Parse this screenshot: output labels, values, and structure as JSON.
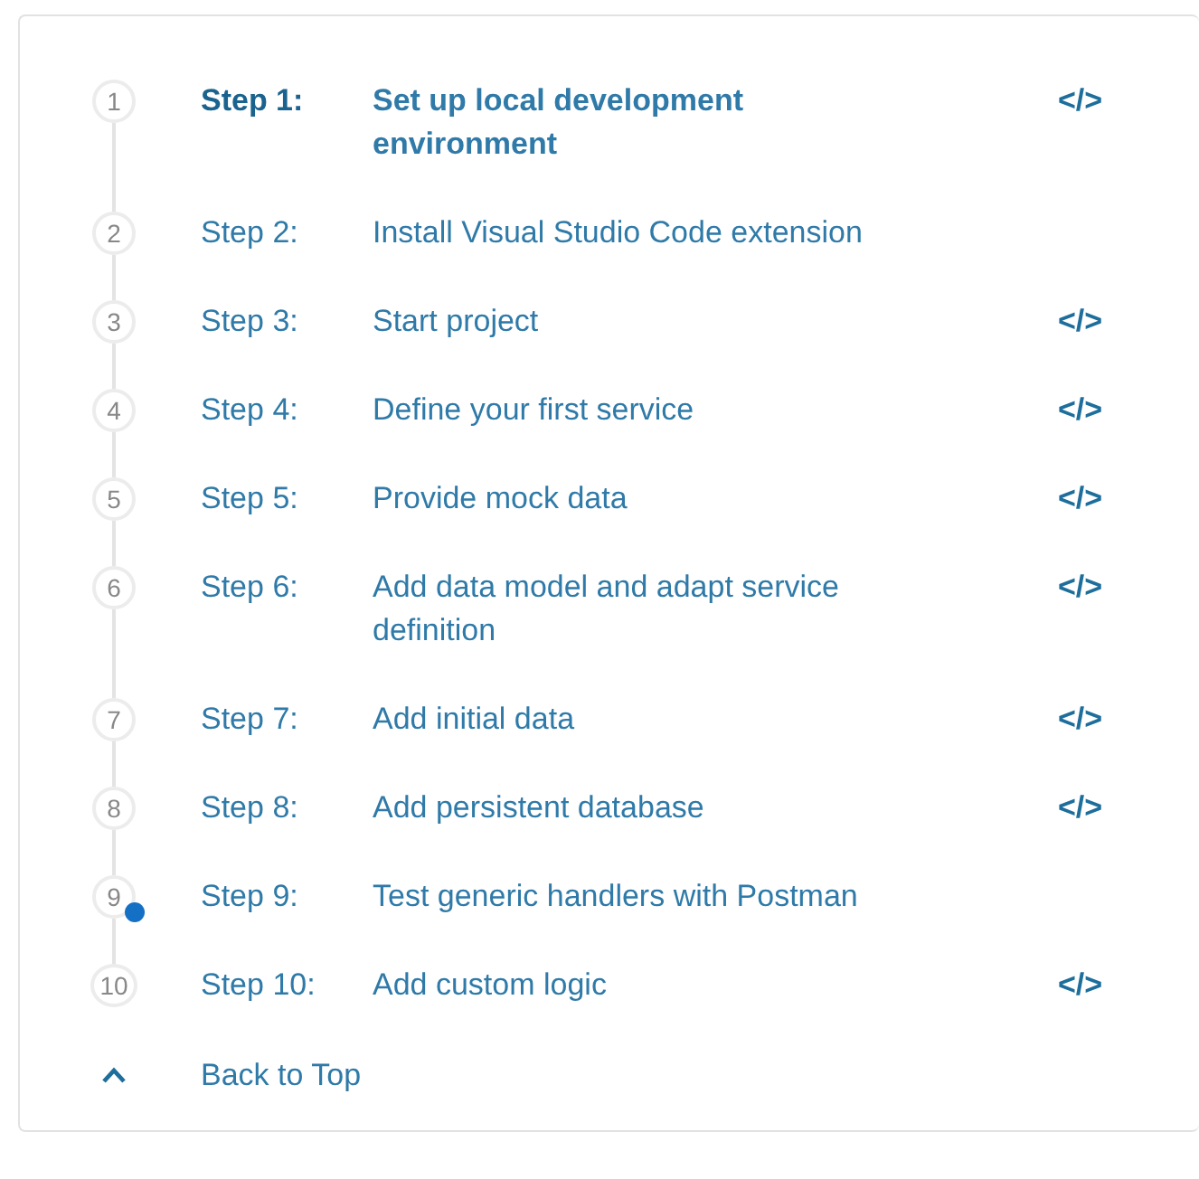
{
  "steps": [
    {
      "number": "1",
      "label": "Step 1:",
      "title": "Set up local development environment",
      "code": "</>",
      "selected": true,
      "marked": false
    },
    {
      "number": "2",
      "label": "Step 2:",
      "title": "Install Visual Studio Code extension",
      "selected": false,
      "marked": false
    },
    {
      "number": "3",
      "label": "Step 3:",
      "title": "Start project",
      "code": "</>",
      "selected": false,
      "marked": false
    },
    {
      "number": "4",
      "label": "Step 4:",
      "title": "Define your first service",
      "code": "</>",
      "selected": false,
      "marked": false
    },
    {
      "number": "5",
      "label": "Step 5:",
      "title": "Provide mock data",
      "code": "</>",
      "selected": false,
      "marked": false
    },
    {
      "number": "6",
      "label": "Step 6:",
      "title": "Add data model and adapt service definition",
      "code": "</>",
      "selected": false,
      "marked": false
    },
    {
      "number": "7",
      "label": "Step 7:",
      "title": "Add initial data",
      "code": "</>",
      "selected": false,
      "marked": false
    },
    {
      "number": "8",
      "label": "Step 8:",
      "title": "Add persistent database",
      "code": "</>",
      "selected": false,
      "marked": false
    },
    {
      "number": "9",
      "label": "Step 9:",
      "title": "Test generic handlers with Postman",
      "selected": false,
      "marked": true
    },
    {
      "number": "10",
      "label": "Step 10:",
      "title": "Add custom logic",
      "code": "</>",
      "selected": false,
      "marked": false
    }
  ],
  "back_to_top": {
    "label": "Back to Top"
  }
}
